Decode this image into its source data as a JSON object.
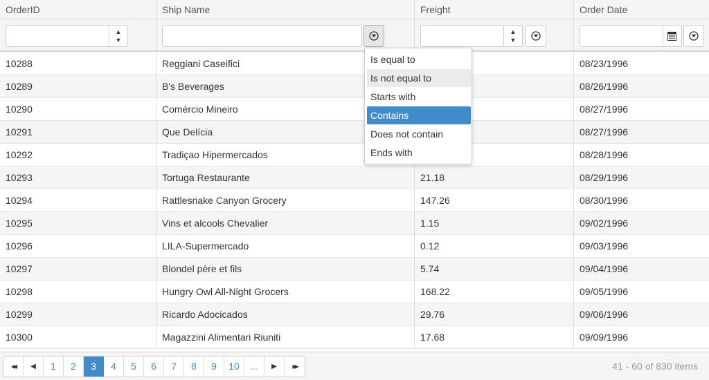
{
  "columns": [
    {
      "label": "OrderID"
    },
    {
      "label": "Ship Name"
    },
    {
      "label": "Freight"
    },
    {
      "label": "Order Date"
    }
  ],
  "filters": {
    "orderid_value": "",
    "shipname_value": "",
    "freight_value": "",
    "orderdate_value": "",
    "spin_up": "▲",
    "spin_down": "▼"
  },
  "rows": [
    {
      "id": "10288",
      "ship": "Reggiani Caseifici",
      "freight": "",
      "date": "08/23/1996"
    },
    {
      "id": "10289",
      "ship": "B's Beverages",
      "freight": "",
      "date": "08/26/1996"
    },
    {
      "id": "10290",
      "ship": "Comércio Mineiro",
      "freight": "",
      "date": "08/27/1996"
    },
    {
      "id": "10291",
      "ship": "Que Delícia",
      "freight": "",
      "date": "08/27/1996"
    },
    {
      "id": "10292",
      "ship": "Tradiçao Hipermercados",
      "freight": "",
      "date": "08/28/1996"
    },
    {
      "id": "10293",
      "ship": "Tortuga Restaurante",
      "freight": "21.18",
      "date": "08/29/1996"
    },
    {
      "id": "10294",
      "ship": "Rattlesnake Canyon Grocery",
      "freight": "147.26",
      "date": "08/30/1996"
    },
    {
      "id": "10295",
      "ship": "Vins et alcools Chevalier",
      "freight": "1.15",
      "date": "09/02/1996"
    },
    {
      "id": "10296",
      "ship": "LILA-Supermercado",
      "freight": "0.12",
      "date": "09/03/1996"
    },
    {
      "id": "10297",
      "ship": "Blondel père et fils",
      "freight": "5.74",
      "date": "09/04/1996"
    },
    {
      "id": "10298",
      "ship": "Hungry Owl All-Night Grocers",
      "freight": "168.22",
      "date": "09/05/1996"
    },
    {
      "id": "10299",
      "ship": "Ricardo Adocicados",
      "freight": "29.76",
      "date": "09/06/1996"
    },
    {
      "id": "10300",
      "ship": "Magazzini Alimentari Riuniti",
      "freight": "17.68",
      "date": "09/09/1996"
    }
  ],
  "filter_menu": {
    "items": [
      "Is equal to",
      "Is not equal to",
      "Starts with",
      "Contains",
      "Does not contain",
      "Ends with"
    ],
    "hovered": "Is not equal to",
    "selected": "Contains"
  },
  "pager": {
    "first": "◀◀",
    "prev": "◀",
    "pages": [
      "1",
      "2",
      "3",
      "4",
      "5",
      "6",
      "7",
      "8",
      "9",
      "10",
      "..."
    ],
    "current_page": "3",
    "next": "▶",
    "last": "▶▶",
    "info": "41 - 60 of 830 items"
  },
  "colors": {
    "accent": "#428bca",
    "header_bg": "#f5f5f5",
    "alt_row": "#f5f5f5"
  }
}
